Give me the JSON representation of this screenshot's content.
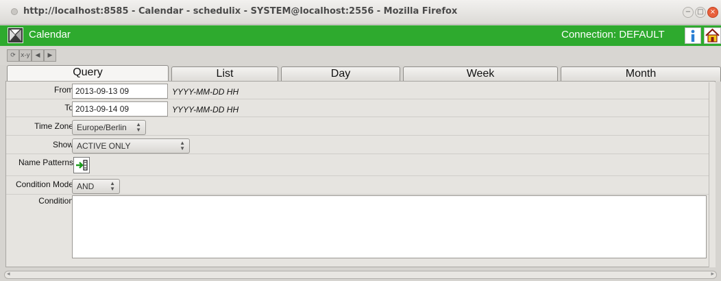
{
  "window": {
    "title": "http://localhost:8585 - Calendar - schedulix - SYSTEM@localhost:2556 - Mozilla Firefox",
    "minimize_glyph": "−",
    "maximize_glyph": "□",
    "close_glyph": "×"
  },
  "app": {
    "title": "Calendar",
    "connection": "Connection:  DEFAULT",
    "icons": [
      "calendar-icon",
      "info-icon",
      "home-icon"
    ],
    "accent_color": "#2eaa2e"
  },
  "toolbar": {
    "buttons": [
      "refresh-icon",
      "x-y-icon",
      "back-icon",
      "forward-icon"
    ],
    "xy_label": "x-y"
  },
  "tabs": [
    {
      "label": "Query",
      "active": true
    },
    {
      "label": "List",
      "active": false
    },
    {
      "label": "Day",
      "active": false
    },
    {
      "label": "Week",
      "active": false
    },
    {
      "label": "Month",
      "active": false
    }
  ],
  "form": {
    "from": {
      "label": "From",
      "value": "2013-09-13 09",
      "hint": "YYYY-MM-DD HH"
    },
    "to": {
      "label": "To",
      "value": "2013-09-14 09",
      "hint": "YYYY-MM-DD HH"
    },
    "time_zone": {
      "label": "Time Zone",
      "value": "Europe/Berlin"
    },
    "show": {
      "label": "Show",
      "value": "ACTIVE ONLY"
    },
    "name_patterns": {
      "label": "Name Patterns"
    },
    "condition_mode": {
      "label": "Condition Mode",
      "value": "AND"
    },
    "condition": {
      "label": "Condition",
      "value": ""
    }
  }
}
